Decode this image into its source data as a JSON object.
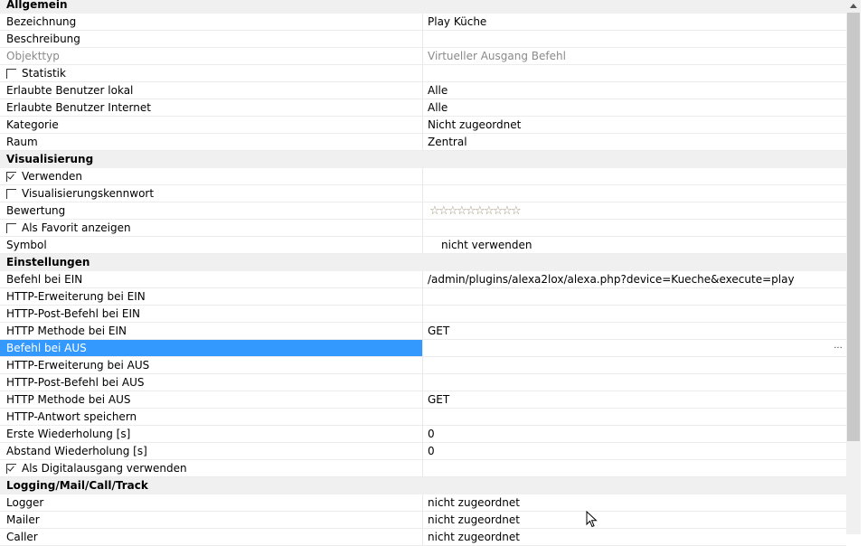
{
  "sections": [
    {
      "title": "Allgemein",
      "rows": [
        {
          "name": "Bezeichnung",
          "value": "Play Küche"
        },
        {
          "name": "Beschreibung",
          "value": ""
        },
        {
          "name": "Objekttyp",
          "value": "Virtueller Ausgang Befehl",
          "disabled": true
        },
        {
          "name": "Statistik",
          "value": "",
          "checkbox": true,
          "checked": false
        },
        {
          "name": "Erlaubte Benutzer lokal",
          "value": "Alle"
        },
        {
          "name": "Erlaubte Benutzer Internet",
          "value": "Alle"
        },
        {
          "name": "Kategorie",
          "value": "Nicht zugeordnet"
        },
        {
          "name": "Raum",
          "value": "Zentral"
        }
      ]
    },
    {
      "title": "Visualisierung",
      "rows": [
        {
          "name": "Verwenden",
          "value": "",
          "checkbox": true,
          "checked": true
        },
        {
          "name": "Visualisierungskennwort",
          "value": "",
          "checkbox": true,
          "checked": false
        },
        {
          "name": "Bewertung",
          "value": "",
          "stars": 10,
          "stars_filled": 0
        },
        {
          "name": "Als Favorit anzeigen",
          "value": "",
          "checkbox": true,
          "checked": false
        },
        {
          "name": "Symbol",
          "value": "nicht verwenden",
          "indent": true
        }
      ]
    },
    {
      "title": "Einstellungen",
      "rows": [
        {
          "name": "Befehl bei EIN",
          "value": "/admin/plugins/alexa2lox/alexa.php?device=Kueche&execute=play"
        },
        {
          "name": "HTTP-Erweiterung bei EIN",
          "value": ""
        },
        {
          "name": "HTTP-Post-Befehl bei EIN",
          "value": ""
        },
        {
          "name": "HTTP Methode bei EIN",
          "value": "GET"
        },
        {
          "name": "Befehl bei AUS",
          "value": "",
          "selected": true,
          "ellipsis": "..."
        },
        {
          "name": "HTTP-Erweiterung bei AUS",
          "value": ""
        },
        {
          "name": "HTTP-Post-Befehl bei AUS",
          "value": ""
        },
        {
          "name": "HTTP Methode bei AUS",
          "value": "GET"
        },
        {
          "name": "HTTP-Antwort speichern",
          "value": ""
        },
        {
          "name": "Erste Wiederholung [s]",
          "value": "0"
        },
        {
          "name": "Abstand Wiederholung [s]",
          "value": "0"
        },
        {
          "name": "Als Digitalausgang verwenden",
          "value": "",
          "checkbox": true,
          "checked": true
        }
      ]
    },
    {
      "title": "Logging/Mail/Call/Track",
      "rows": [
        {
          "name": "Logger",
          "value": "nicht zugeordnet"
        },
        {
          "name": "Mailer",
          "value": "nicht zugeordnet"
        },
        {
          "name": "Caller",
          "value": "nicht zugeordnet"
        }
      ]
    }
  ]
}
